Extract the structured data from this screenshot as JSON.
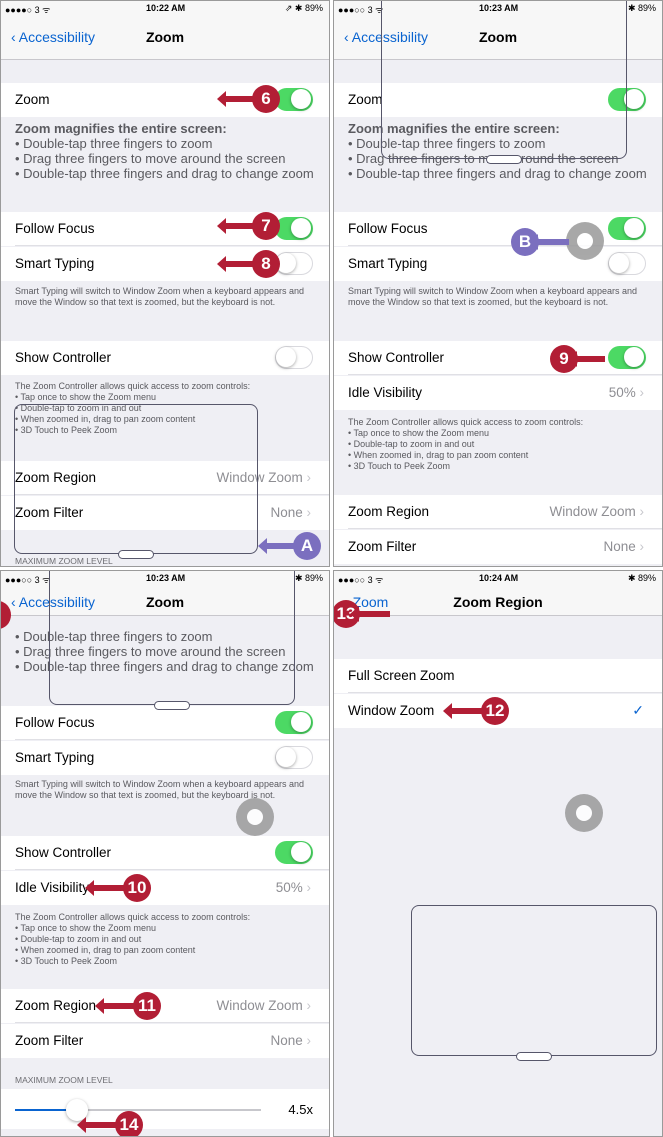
{
  "panel1": {
    "status": {
      "carrier": "●●●●○ 3 ᯤ",
      "time": "10:22 AM",
      "battery": "⇗ ✱ 89%"
    },
    "nav": {
      "back": "Accessibility",
      "title": "Zoom"
    },
    "zoom_label": "Zoom",
    "zoom_desc": "Zoom magnifies the entire screen:",
    "zoom_bullets": "• Double-tap three fingers to zoom\n• Drag three fingers to move around the screen\n• Double-tap three fingers and drag to change zoom",
    "follow_focus": "Follow Focus",
    "smart_typing": "Smart Typing",
    "smart_desc": "Smart Typing will switch to Window Zoom when a keyboard appears and move the Window so that text is zoomed, but the keyboard is not.",
    "show_controller": "Show Controller",
    "controller_desc": "The Zoom Controller allows quick access to zoom controls:\n• Tap once to show the Zoom menu\n• Double-tap to zoom in and out\n• When zoomed in, drag to pan zoom content\n• 3D Touch to Peek Zoom",
    "zoom_region": "Zoom Region",
    "zoom_region_value": "Window Zoom",
    "zoom_filter": "Zoom Filter",
    "zoom_filter_value": "None",
    "max_zoom": "MAXIMUM ZOOM LEVEL"
  },
  "panel2": {
    "status": {
      "carrier": "●●●○○ 3 ᯤ",
      "time": "10:23 AM",
      "battery": "✱ 89%"
    },
    "nav": {
      "back": "Accessibility",
      "title": "Zoom"
    },
    "zoom_label": "Zoom",
    "zoom_desc": "Zoom magnifies the entire screen:",
    "zoom_bullets": "• Double-tap three fingers to zoom\n• Drag three fingers to move around the screen\n• Double-tap three fingers and drag to change zoom",
    "follow_focus": "Follow Focus",
    "smart_typing": "Smart Typing",
    "smart_desc": "Smart Typing will switch to Window Zoom when a keyboard appears and move the Window so that text is zoomed, but the keyboard is not.",
    "show_controller": "Show Controller",
    "idle_visibility": "Idle Visibility",
    "idle_value": "50%",
    "controller_desc": "The Zoom Controller allows quick access to zoom controls:\n• Tap once to show the Zoom menu\n• Double-tap to zoom in and out\n• When zoomed in, drag to pan zoom content\n• 3D Touch to Peek Zoom",
    "zoom_region": "Zoom Region",
    "zoom_region_value": "Window Zoom",
    "zoom_filter": "Zoom Filter",
    "zoom_filter_value": "None"
  },
  "panel3": {
    "status": {
      "carrier": "●●●○○ 3 ᯤ",
      "time": "10:23 AM",
      "battery": "✱ 89%"
    },
    "nav": {
      "back": "Accessibility",
      "title": "Zoom"
    },
    "zoom_bullets": "• Double-tap three fingers to zoom\n• Drag three fingers to move around the screen\n• Double-tap three fingers and drag to change zoom",
    "follow_focus": "Follow Focus",
    "smart_typing": "Smart Typing",
    "smart_desc": "Smart Typing will switch to Window Zoom when a keyboard appears and move the Window so that text is zoomed, but the keyboard is not.",
    "show_controller": "Show Controller",
    "idle_visibility": "Idle Visibility",
    "idle_value": "50%",
    "controller_desc": "The Zoom Controller allows quick access to zoom controls:\n• Tap once to show the Zoom menu\n• Double-tap to zoom in and out\n• When zoomed in, drag to pan zoom content\n• 3D Touch to Peek Zoom",
    "zoom_region": "Zoom Region",
    "zoom_region_value": "Window Zoom",
    "zoom_filter": "Zoom Filter",
    "zoom_filter_value": "None",
    "max_zoom": "MAXIMUM ZOOM LEVEL",
    "zoom_level": "4.5x",
    "zoom_level_fraction": 0.25
  },
  "panel4": {
    "status": {
      "carrier": "●●●○○ 3 ᯤ",
      "time": "10:24 AM",
      "battery": "✱ 89%"
    },
    "nav": {
      "back": "Zoom",
      "title": "Zoom Region"
    },
    "full_screen": "Full Screen Zoom",
    "window_zoom": "Window Zoom"
  },
  "callouts": {
    "c6": "6",
    "c7": "7",
    "c8": "8",
    "cA": "A",
    "cB": "B",
    "c9": "9",
    "c10": "10",
    "c11": "11",
    "c12": "12",
    "c13": "13",
    "c14": "14"
  },
  "colors": {
    "callout": "#b21e35",
    "letter_callout": "#7b6fbf",
    "toggle_on": "#4cd964",
    "link": "#0a64d0"
  }
}
